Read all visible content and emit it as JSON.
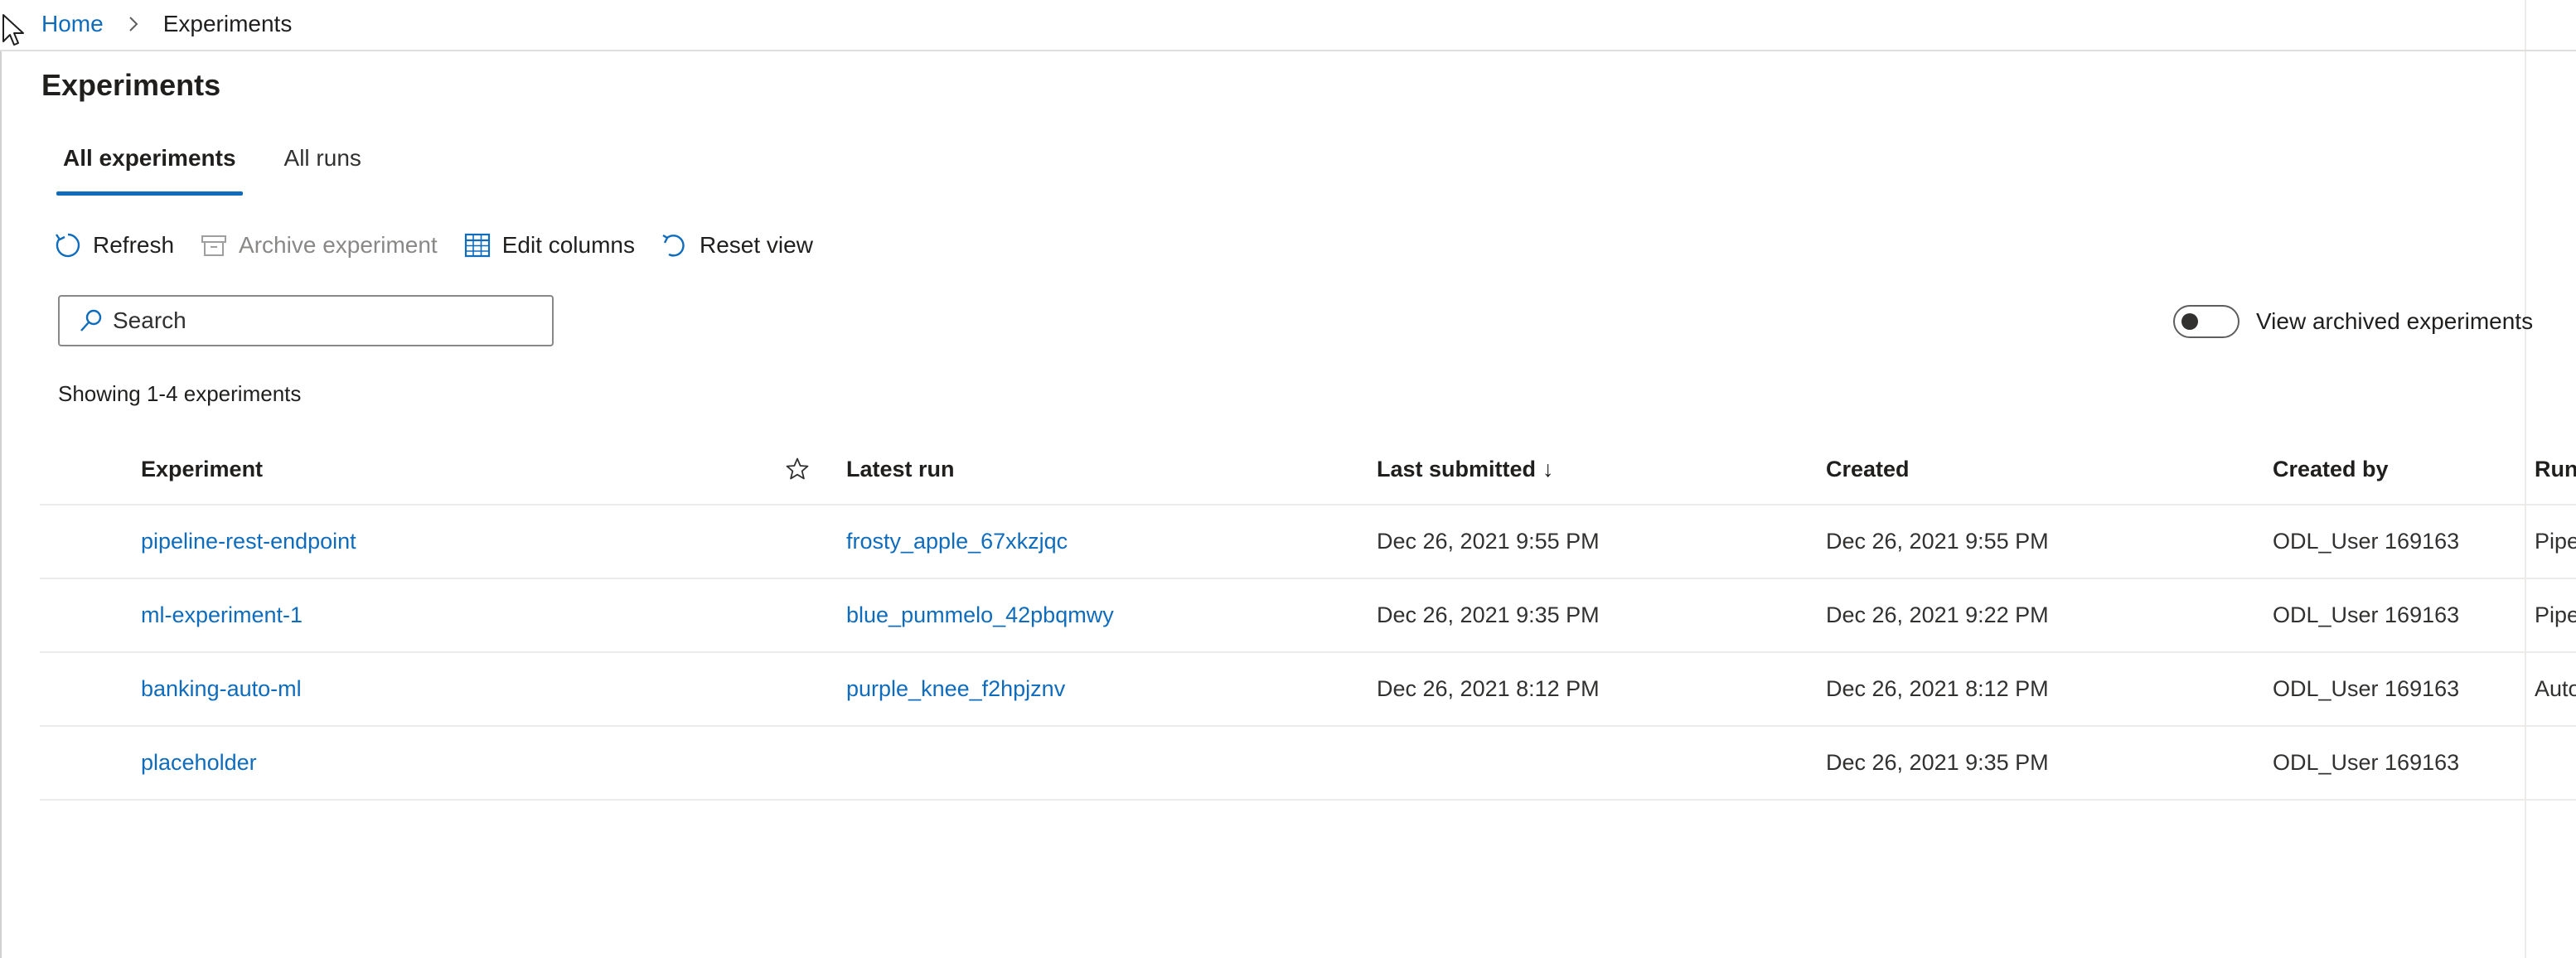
{
  "breadcrumb": {
    "home": "Home",
    "current": "Experiments"
  },
  "page": {
    "title": "Experiments"
  },
  "tabs": [
    {
      "label": "All experiments",
      "active": true
    },
    {
      "label": "All runs",
      "active": false
    }
  ],
  "toolbar": {
    "refresh": "Refresh",
    "archive": "Archive experiment",
    "edit_columns": "Edit columns",
    "reset_view": "Reset view"
  },
  "search": {
    "placeholder": "Search",
    "value": ""
  },
  "archived_toggle": {
    "label": "View archived experiments",
    "on": false
  },
  "count_text": "Showing 1-4 experiments",
  "table": {
    "columns": {
      "experiment": "Experiment",
      "latest_run": "Latest run",
      "last_submitted": "Last submitted",
      "sort_indicator": "↓",
      "created": "Created",
      "created_by": "Created by",
      "run_type": "Run"
    },
    "rows": [
      {
        "experiment": "pipeline-rest-endpoint",
        "latest_run": "frosty_apple_67xkzjqc",
        "last_submitted": "Dec 26, 2021 9:55 PM",
        "created": "Dec 26, 2021 9:55 PM",
        "created_by": "ODL_User 169163",
        "run_type": "Pipe"
      },
      {
        "experiment": "ml-experiment-1",
        "latest_run": "blue_pummelo_42pbqmwy",
        "last_submitted": "Dec 26, 2021 9:35 PM",
        "created": "Dec 26, 2021 9:22 PM",
        "created_by": "ODL_User 169163",
        "run_type": "Pipe"
      },
      {
        "experiment": "banking-auto-ml",
        "latest_run": "purple_knee_f2hpjznv",
        "last_submitted": "Dec 26, 2021 8:12 PM",
        "created": "Dec 26, 2021 8:12 PM",
        "created_by": "ODL_User 169163",
        "run_type": "Auto"
      },
      {
        "experiment": "placeholder",
        "latest_run": "",
        "last_submitted": "",
        "created": "Dec 26, 2021 9:35 PM",
        "created_by": "ODL_User 169163",
        "run_type": ""
      }
    ]
  },
  "colors": {
    "accent": "#0f6cbd",
    "text": "#201f1e",
    "muted": "#8a8886",
    "divider": "#edebe9"
  }
}
